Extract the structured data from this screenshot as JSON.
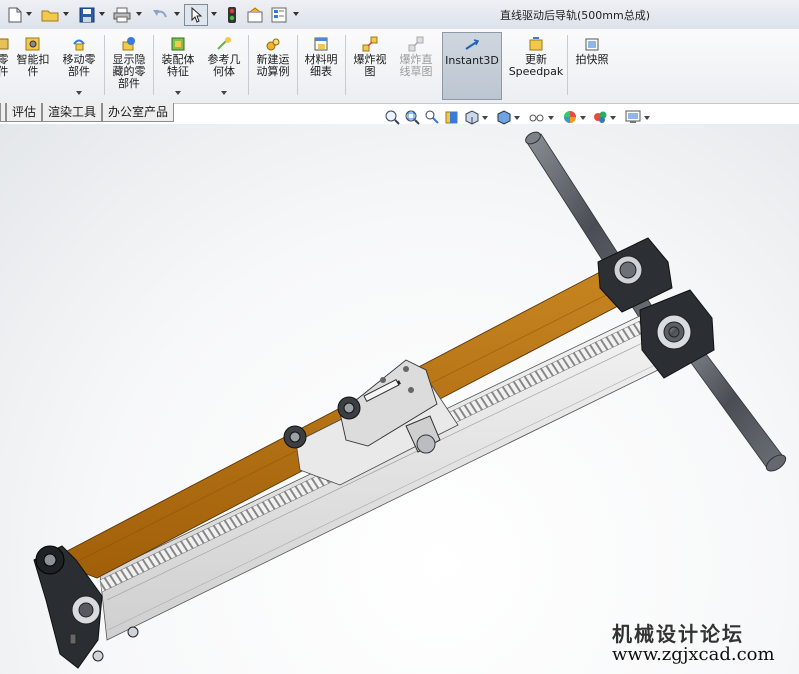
{
  "window": {
    "title": "直线驱动后导轨(500mm总成)"
  },
  "quick_access": {
    "icons": [
      "new-document-icon",
      "open-folder-icon",
      "save-icon",
      "print-icon",
      "undo-icon",
      "select-pointer-icon",
      "rebuild-icon",
      "options-icon",
      "customize-icon"
    ]
  },
  "ribbon": {
    "buttons": [
      {
        "label": "零\n件",
        "icon": "component-icon",
        "enabled": true,
        "dropdown": false
      },
      {
        "label": "智能扣\n件",
        "icon": "smart-fastener-icon",
        "enabled": true,
        "dropdown": false
      },
      {
        "label": "移动零\n部件",
        "icon": "move-component-icon",
        "enabled": true,
        "dropdown": true
      },
      {
        "label": "显示隐\n藏的零\n部件",
        "icon": "show-hidden-icon",
        "enabled": true,
        "dropdown": false
      },
      {
        "label": "装配体\n特征",
        "icon": "assembly-feature-icon",
        "enabled": true,
        "dropdown": true
      },
      {
        "label": "参考几\n何体",
        "icon": "reference-geometry-icon",
        "enabled": true,
        "dropdown": true
      },
      {
        "label": "新建运\n动算例",
        "icon": "motion-study-icon",
        "enabled": true,
        "dropdown": false
      },
      {
        "label": "材料明\n细表",
        "icon": "bom-icon",
        "enabled": true,
        "dropdown": false
      },
      {
        "label": "爆炸视\n图",
        "icon": "explode-view-icon",
        "enabled": true,
        "dropdown": false
      },
      {
        "label": "爆炸直\n线草图",
        "icon": "explode-line-icon",
        "enabled": false,
        "dropdown": false
      },
      {
        "label": "Instant3D",
        "icon": "instant3d-icon",
        "enabled": true,
        "dropdown": false,
        "active": true
      },
      {
        "label": "更新\nSpeedpak",
        "icon": "speedpak-icon",
        "enabled": true,
        "dropdown": false
      },
      {
        "label": "拍快照",
        "icon": "snapshot-icon",
        "enabled": true,
        "dropdown": false
      }
    ]
  },
  "tabs": [
    {
      "label": ""
    },
    {
      "label": "评估"
    },
    {
      "label": "渲染工具"
    },
    {
      "label": "办公室产品"
    }
  ],
  "view_toolbar": {
    "icons": [
      "zoom-fit-icon",
      "zoom-area-icon",
      "previous-view-icon",
      "section-view-icon",
      "view-orientation-icon",
      "display-style-icon",
      "hide-show-icon",
      "edit-appearance-icon",
      "apply-scene-icon",
      "view-settings-icon"
    ]
  },
  "watermark": {
    "cn": "机械设计论坛",
    "url": "www.zgjxcad.com"
  },
  "colors": {
    "belt": "#b8700f",
    "rail": "#e8e8e8",
    "shaft": "#5d6167",
    "accent": "#1e63b8"
  }
}
